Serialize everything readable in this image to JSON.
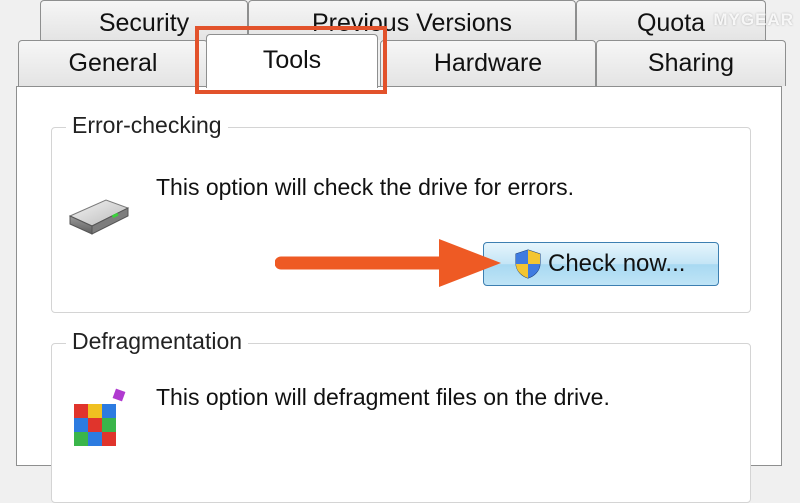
{
  "tabs": {
    "row1": [
      {
        "label": "Security"
      },
      {
        "label": "Previous Versions"
      },
      {
        "label": "Quota"
      }
    ],
    "row2": [
      {
        "label": "General"
      },
      {
        "label": "Tools"
      },
      {
        "label": "Hardware"
      },
      {
        "label": "Sharing"
      }
    ],
    "active": "Tools"
  },
  "error_checking": {
    "title": "Error-checking",
    "description": "This option will check the drive for errors.",
    "button_label": "Check now..."
  },
  "defragmentation": {
    "title": "Defragmentation",
    "description": "This option will defragment files on the drive."
  },
  "watermark": "MYGEAR",
  "colors": {
    "highlight": "#e2522b",
    "arrow": "#ee5a24",
    "button_border": "#3c7fb1"
  },
  "icons": {
    "drive": "hard-drive-icon",
    "shield": "uac-shield-icon",
    "defrag": "defrag-icon"
  }
}
